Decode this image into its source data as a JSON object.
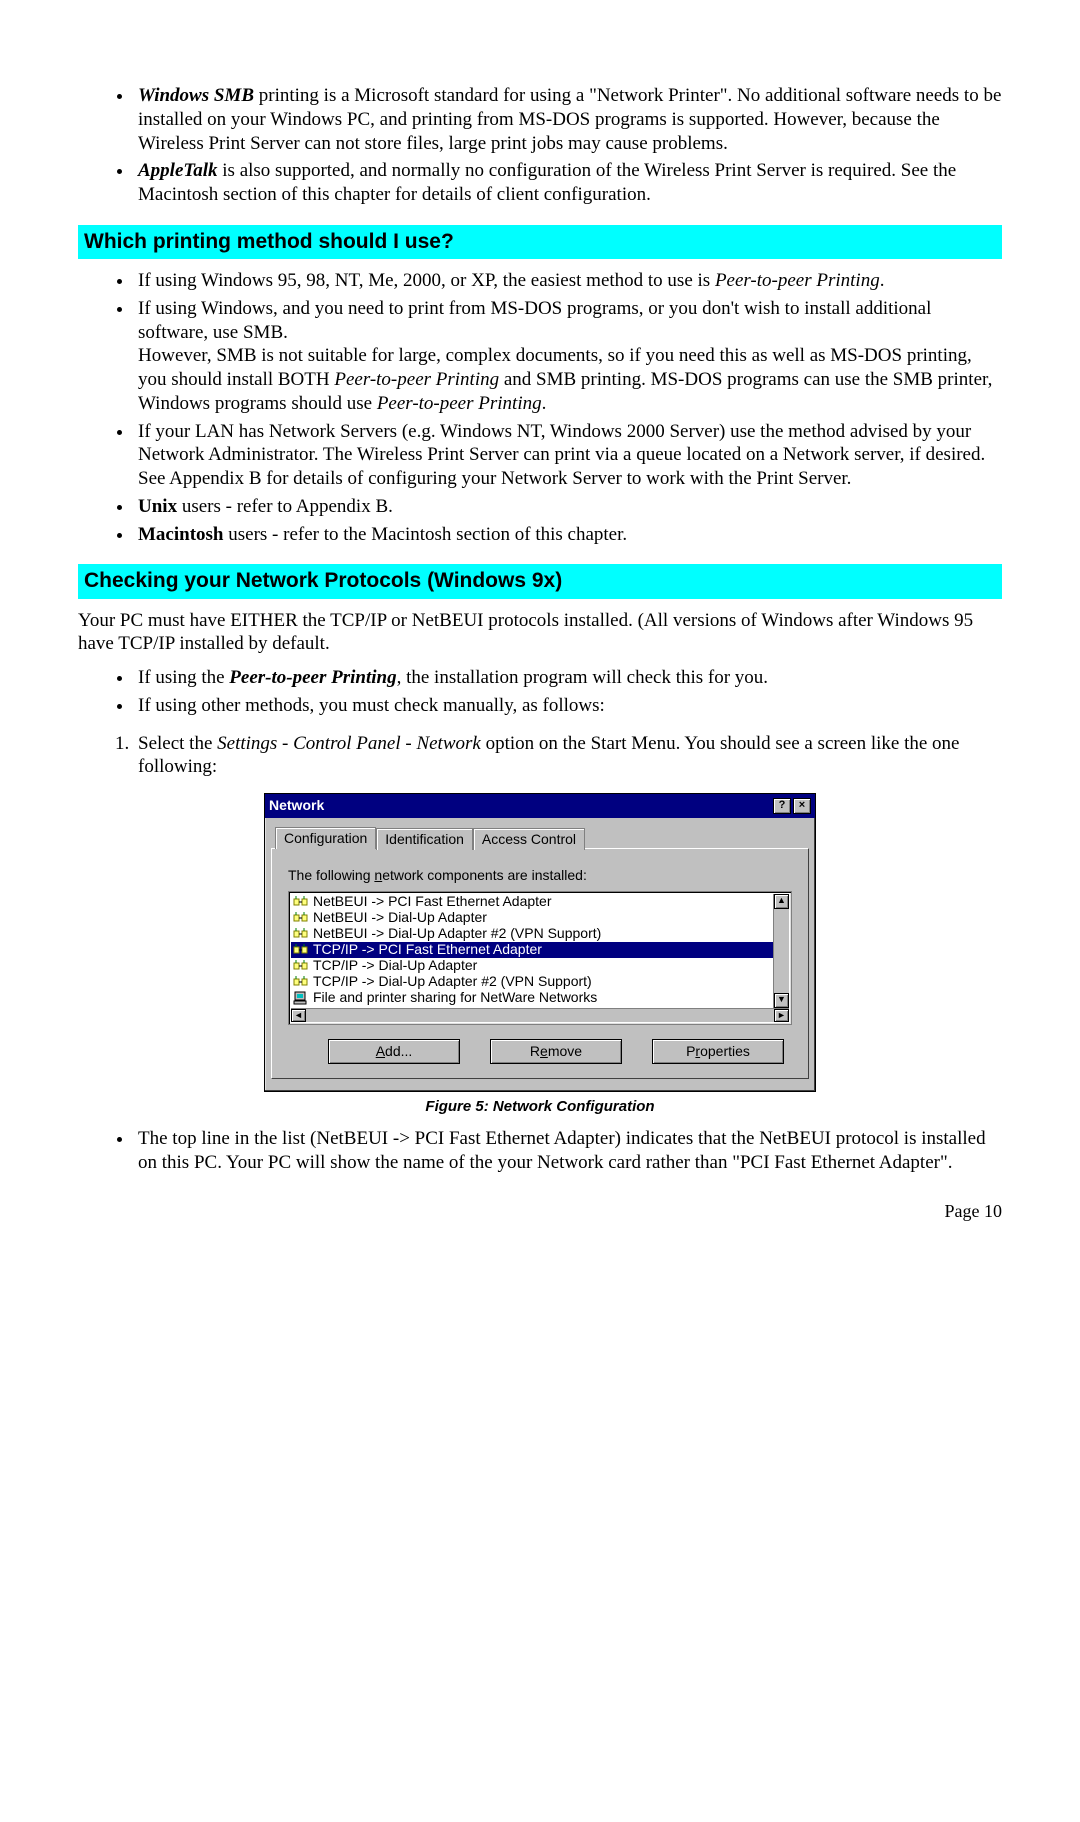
{
  "intro_bullets": {
    "smb_strong": "Windows SMB",
    "smb_rest": " printing is a Microsoft standard for using a \"Network Printer\". No additional software needs to be installed on your Windows PC, and printing from MS-DOS programs is supported. However, because the Wireless Print Server can not store files, large print jobs may cause problems.",
    "apple_strong": "AppleTalk",
    "apple_rest": " is also supported, and normally no configuration of the Wireless Print Server is required. See the Macintosh section of this chapter for details of client configuration."
  },
  "heading1": "Which printing method should I use?",
  "method_bullets": {
    "b1_pre": "If using Windows 95, 98, NT, Me, 2000, or XP, the easiest method to use is ",
    "b1_em": "Peer-to-peer Printing",
    "b1_post": ".",
    "b2_p1": "If using Windows, and you need to print from MS-DOS programs, or you don't wish to install additional software, use SMB.",
    "b2_p2a": "However, SMB is not suitable for large, complex documents, so if you need this as well as MS-DOS printing, you should install BOTH ",
    "b2_em1": "Peer-to-peer Printing",
    "b2_p2b": " and SMB printing. MS-DOS programs can use the SMB printer, Windows programs should use ",
    "b2_em2": "Peer-to-peer Printing",
    "b2_p2c": ".",
    "b3_p1": "If your LAN has Network Servers (e.g. Windows NT, Windows 2000 Server) use the method advised by your Network Administrator. The Wireless Print Server can print via a queue located on a Network server, if desired.",
    "b3_p2": "See Appendix B for details of configuring your Network Server to work with the Print Server.",
    "b4_strong": "Unix",
    "b4_rest": " users - refer to Appendix B.",
    "b5_strong": "Macintosh",
    "b5_rest": " users - refer to the Macintosh section of this chapter."
  },
  "heading2": "Checking your Network Protocols (Windows 9x)",
  "para_after_h2": "Your PC must have EITHER the TCP/IP or NetBEUI protocols installed. (All versions of Windows after Windows 95 have TCP/IP installed by default.",
  "proto_bullets": {
    "b1_pre": "If using the ",
    "b1_em": "Peer-to-peer Printing",
    "b1_post": ", the installation program will check this for you.",
    "b2": "If using other methods, you must check manually, as follows:"
  },
  "step1_pre": "Select the ",
  "step1_em": "Settings - Control Panel - Network",
  "step1_post": " option on the Start Menu. You should see a screen like the one following:",
  "dialog": {
    "title": "Network",
    "tabs": [
      "Configuration",
      "Identification",
      "Access Control"
    ],
    "list_label_pre": "The following ",
    "list_label_u": "n",
    "list_label_post": "etwork components are installed:",
    "items": [
      "NetBEUI -> PCI Fast Ethernet Adapter",
      "NetBEUI -> Dial-Up Adapter",
      "NetBEUI -> Dial-Up Adapter #2 (VPN Support)",
      "TCP/IP -> PCI Fast Ethernet Adapter",
      "TCP/IP -> Dial-Up Adapter",
      "TCP/IP -> Dial-Up Adapter #2 (VPN Support)",
      "File and printer sharing for NetWare Networks"
    ],
    "selected_index": 3,
    "buttons": {
      "add": "Add...",
      "remove": "Remove",
      "properties": "Properties"
    }
  },
  "figure_caption": "Figure 5: Network Configuration",
  "post_fig_bullet": "The top line in the list (NetBEUI -> PCI Fast Ethernet Adapter) indicates that the NetBEUI protocol is installed on this PC. Your PC will show the name of the your Network card rather than \"PCI Fast Ethernet Adapter\".",
  "page_number": "Page 10"
}
